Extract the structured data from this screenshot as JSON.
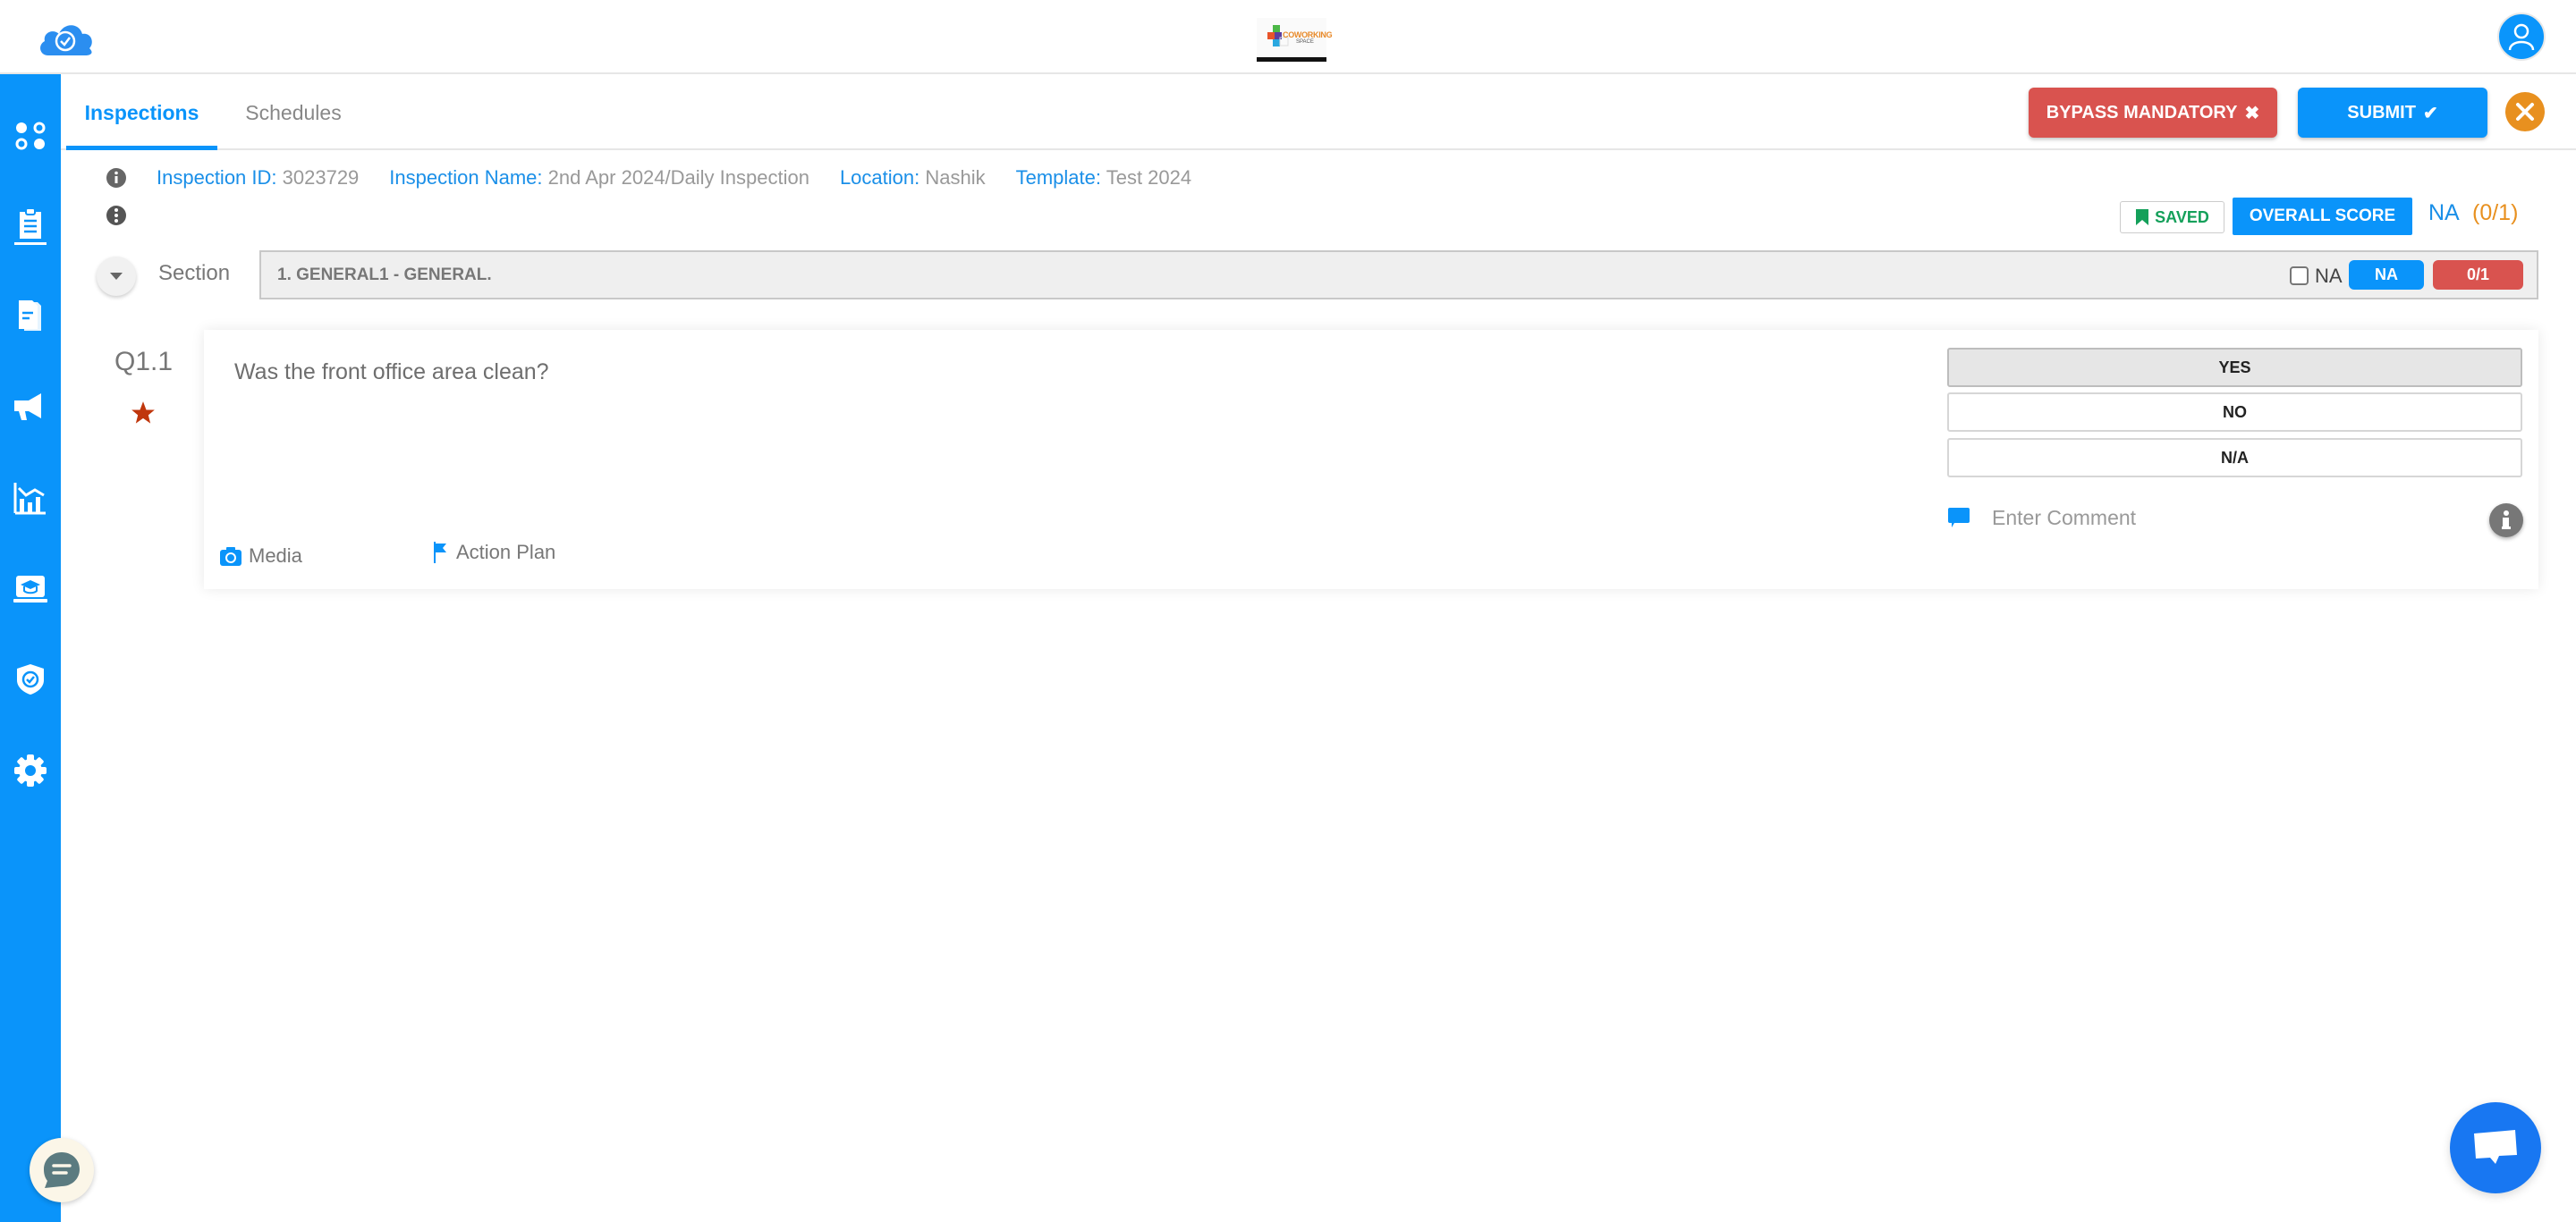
{
  "header": {
    "brand_icon": "cloud-check-icon",
    "center_logo": {
      "text": "COWORKING",
      "subtext": "SPACE"
    },
    "user_icon": "user-icon"
  },
  "sidebar": {
    "items": [
      {
        "name": "dashboard",
        "icon": "apps-dots-icon"
      },
      {
        "name": "inspections",
        "icon": "clipboard-icon"
      },
      {
        "name": "documents",
        "icon": "document-icon"
      },
      {
        "name": "announcements",
        "icon": "megaphone-icon"
      },
      {
        "name": "analytics",
        "icon": "chart-icon"
      },
      {
        "name": "training",
        "icon": "graduation-laptop-icon"
      },
      {
        "name": "compliance",
        "icon": "shield-check-icon"
      },
      {
        "name": "settings",
        "icon": "gear-icon"
      }
    ]
  },
  "tabs": [
    {
      "label": "Inspections",
      "active": true
    },
    {
      "label": "Schedules",
      "active": false
    }
  ],
  "toolbar": {
    "bypass_label": "BYPASS MANDATORY",
    "bypass_icon": "✖",
    "submit_label": "SUBMIT",
    "submit_icon": "✔",
    "close_icon": "✕"
  },
  "inspection": {
    "id_label": "Inspection ID:",
    "id_value": "3023729",
    "name_label": "Inspection Name:",
    "name_value": "2nd Apr 2024/Daily Inspection",
    "location_label": "Location:",
    "location_value": "Nashik",
    "template_label": "Template:",
    "template_value": "Test 2024"
  },
  "score_bar": {
    "saved_label": "SAVED",
    "overall_label": "OVERALL SCORE",
    "score_na": "NA",
    "score_fraction": "(0/1)"
  },
  "section": {
    "label": "Section",
    "title": "1. GENERAL1 - GENERAL.",
    "na_checkbox_label": "NA",
    "na_checked": false,
    "na_pill": "NA",
    "score_pill": "0/1"
  },
  "question": {
    "number": "Q1.1",
    "mandatory": true,
    "text": "Was the front office area clean?",
    "options": [
      {
        "label": "YES",
        "selected": true
      },
      {
        "label": "NO",
        "selected": false
      },
      {
        "label": "N/A",
        "selected": false
      }
    ],
    "comment_placeholder": "Enter Comment",
    "comment_value": "",
    "media_label": "Media",
    "action_plan_label": "Action Plan"
  },
  "colors": {
    "primary": "#0a94fa",
    "danger": "#d9534f",
    "warning": "#e8901f",
    "success": "#14a05a"
  }
}
